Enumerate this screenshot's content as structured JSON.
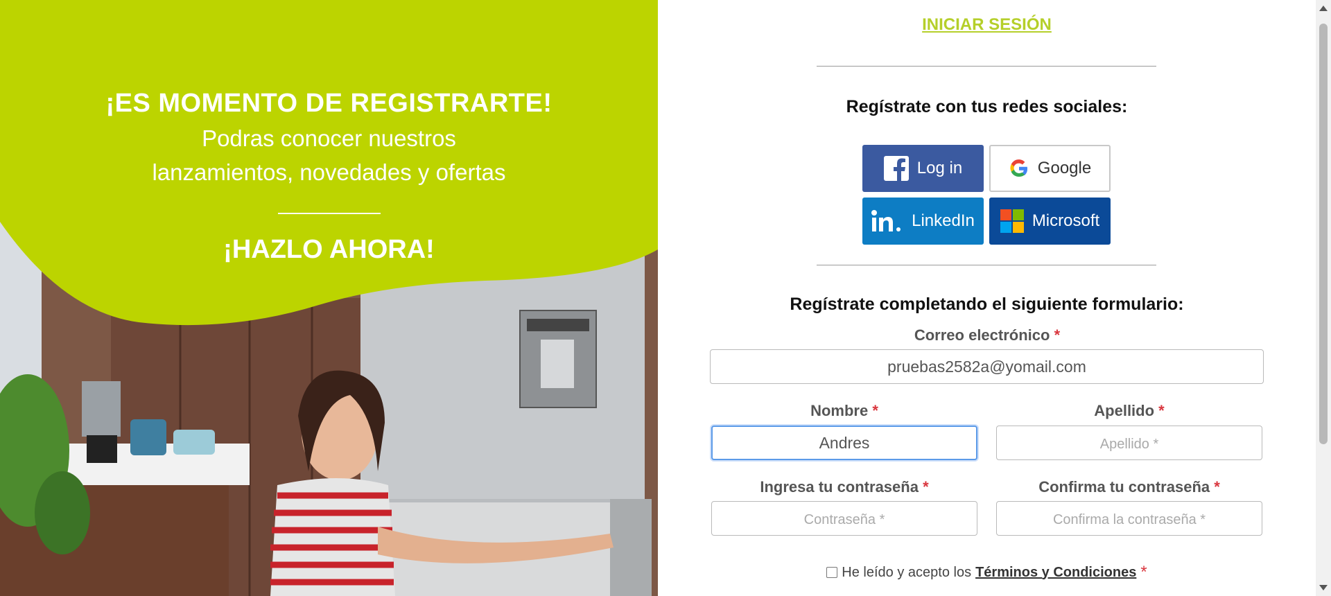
{
  "hero": {
    "headline": "¡ES MOMENTO DE REGISTRARTE!",
    "subline_1": "Podras conocer nuestros",
    "subline_2": "lanzamientos, novedades y ofertas",
    "cta": "¡HAZLO AHORA!",
    "accent_color": "#bcd400"
  },
  "header": {
    "login_link": "INICIAR SESIÓN"
  },
  "social": {
    "title": "Regístrate con tus redes sociales:",
    "buttons": [
      {
        "label": "Log in",
        "icon": "facebook-icon",
        "color": "#3b5aa0"
      },
      {
        "label": "Google",
        "icon": "google-icon",
        "color": "#ffffff"
      },
      {
        "label": "LinkedIn",
        "icon": "linkedin-icon",
        "color": "#0d7dc4"
      },
      {
        "label": "Microsoft",
        "icon": "microsoft-icon",
        "color": "#0b4a98"
      }
    ]
  },
  "form": {
    "title": "Regístrate completando el siguiente formulario:",
    "required_mark": "*",
    "email": {
      "label": "Correo electrónico",
      "value": "pruebas2582a@yomail.com"
    },
    "first_name": {
      "label": "Nombre",
      "value": "Andres"
    },
    "last_name": {
      "label": "Apellido",
      "value": "",
      "placeholder": "Apellido *"
    },
    "password": {
      "label": "Ingresa tu contraseña",
      "value": "",
      "placeholder": "Contraseña *"
    },
    "confirm_password": {
      "label": "Confirma tu contraseña",
      "value": "",
      "placeholder": "Confirma la contraseña *"
    },
    "terms": {
      "prefix": "He leído y acepto los",
      "link": "Términos y Condiciones",
      "checked": false
    }
  }
}
